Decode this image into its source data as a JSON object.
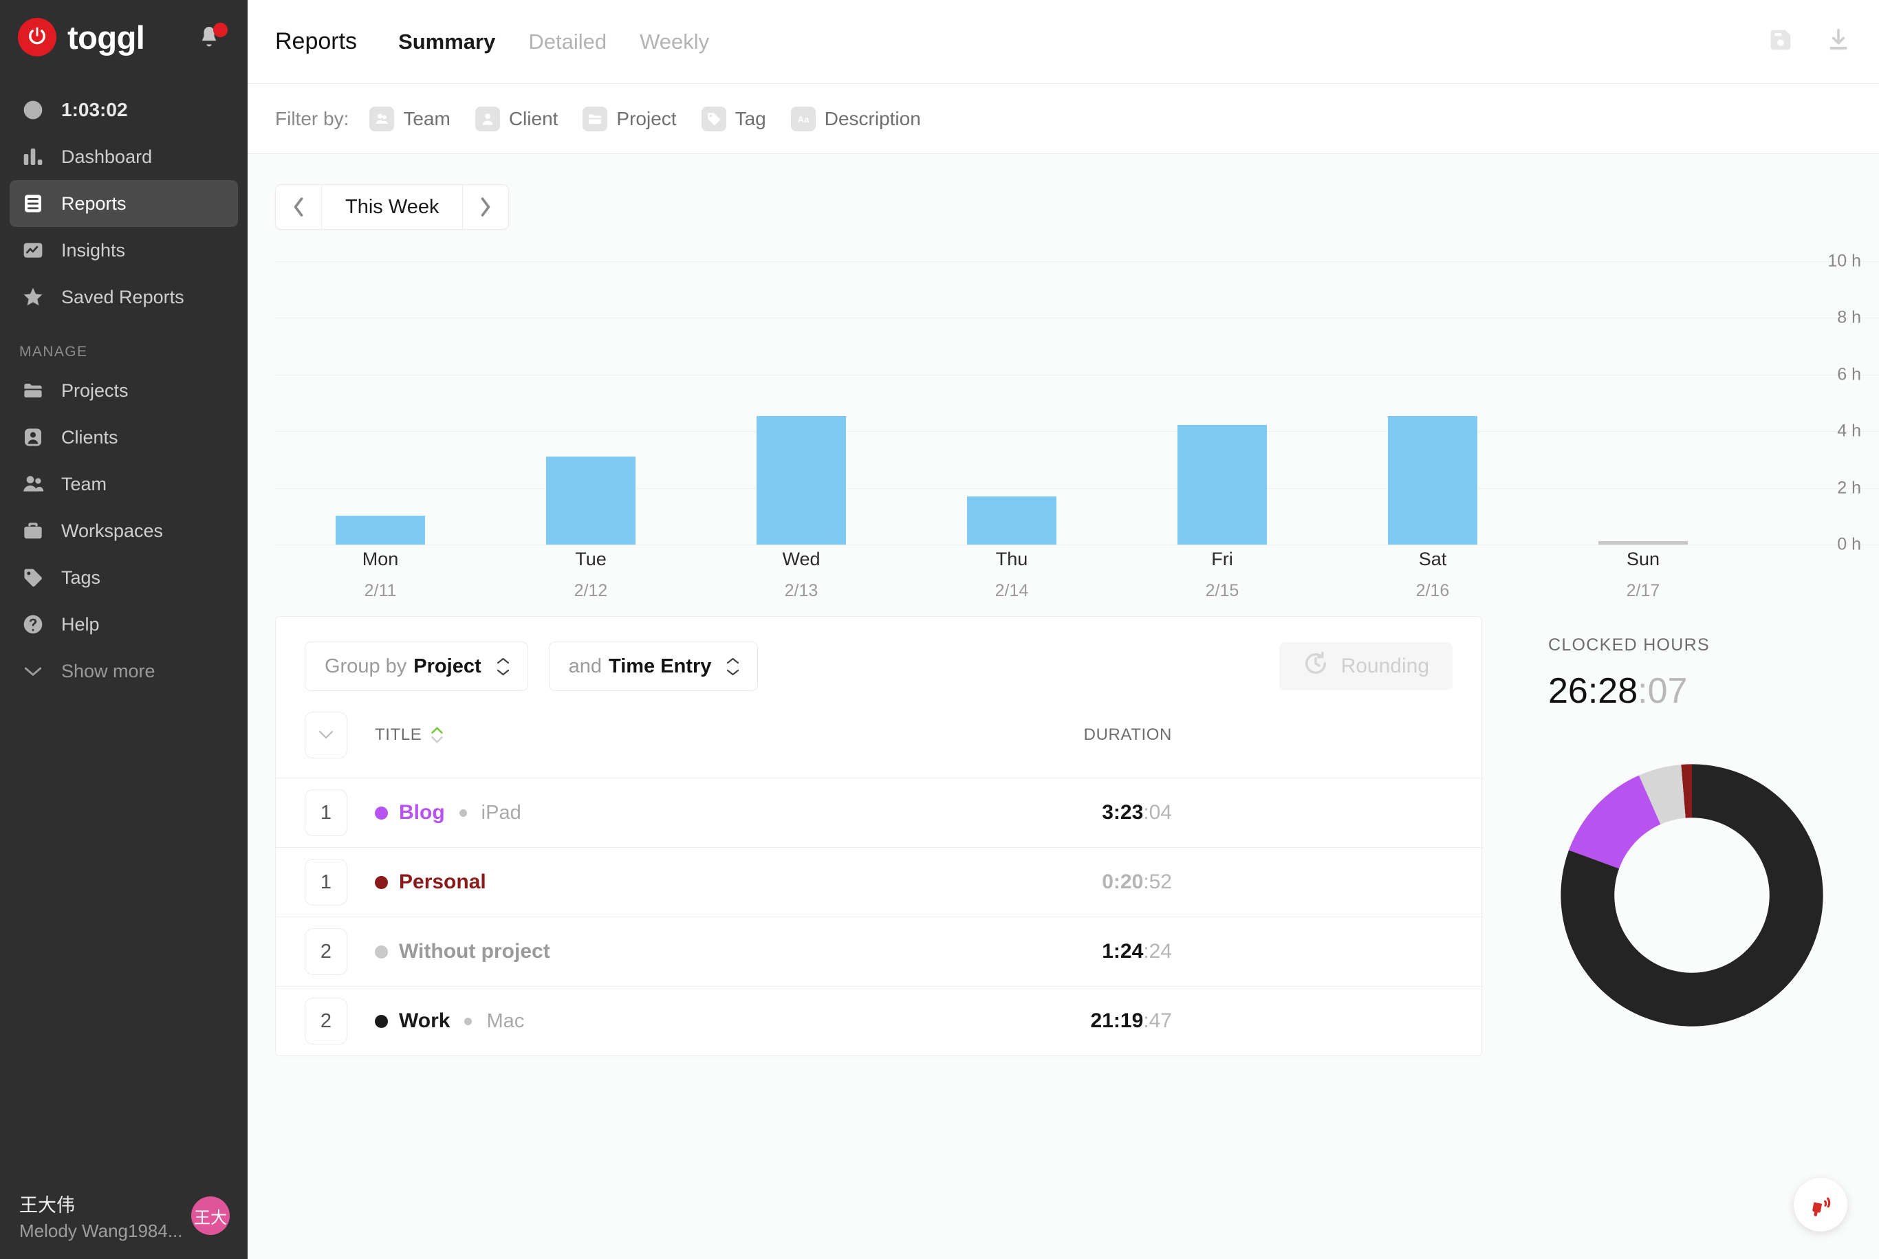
{
  "brand": {
    "name": "toggl",
    "logo_icon": "power-icon",
    "bell_icon": "bell-icon",
    "has_notification": true
  },
  "sidebar": {
    "timer": {
      "label": "1:03:02",
      "icon": "clock-icon"
    },
    "primary_items": [
      {
        "label": "Dashboard",
        "icon": "bar-chart-icon",
        "active": false
      },
      {
        "label": "Reports",
        "icon": "report-icon",
        "active": true
      },
      {
        "label": "Insights",
        "icon": "insights-icon",
        "active": false
      },
      {
        "label": "Saved Reports",
        "icon": "star-icon",
        "active": false
      }
    ],
    "manage_label": "MANAGE",
    "manage_items": [
      {
        "label": "Projects",
        "icon": "folder-icon"
      },
      {
        "label": "Clients",
        "icon": "person-square-icon"
      },
      {
        "label": "Team",
        "icon": "people-icon"
      },
      {
        "label": "Workspaces",
        "icon": "briefcase-icon"
      },
      {
        "label": "Tags",
        "icon": "tag-icon"
      },
      {
        "label": "Help",
        "icon": "question-circle-icon"
      }
    ],
    "show_more": {
      "label": "Show more",
      "icon": "chevron-down-icon"
    },
    "user": {
      "name": "王大伟",
      "email": "Melody Wang1984...",
      "avatar_initials": "王大"
    }
  },
  "header": {
    "page_title": "Reports",
    "tabs": [
      {
        "label": "Summary",
        "active": true
      },
      {
        "label": "Detailed",
        "active": false
      },
      {
        "label": "Weekly",
        "active": false
      }
    ],
    "actions": [
      {
        "name": "save-report-button",
        "icon": "floppy-disk-icon"
      },
      {
        "name": "download-button",
        "icon": "download-icon"
      }
    ]
  },
  "filterbar": {
    "label": "Filter by:",
    "filters": [
      {
        "label": "Team",
        "icon": "team-icon"
      },
      {
        "label": "Client",
        "icon": "client-icon"
      },
      {
        "label": "Project",
        "icon": "project-icon"
      },
      {
        "label": "Tag",
        "icon": "tag-icon"
      },
      {
        "label": "Description",
        "icon": "description-icon"
      }
    ]
  },
  "date_nav": {
    "prev_icon": "chevron-left-icon",
    "label": "This Week",
    "next_icon": "chevron-right-icon"
  },
  "chart_data": {
    "type": "bar",
    "title": "",
    "xlabel": "",
    "ylabel": "",
    "ylim": [
      0,
      10
    ],
    "yticks": [
      "0 h",
      "2 h",
      "4 h",
      "6 h",
      "8 h",
      "10 h"
    ],
    "ytick_values": [
      0,
      2,
      4,
      6,
      8,
      10
    ],
    "grid": true,
    "bar_color": "#7fc9f2",
    "zero_marker_color": "#c8c8c8",
    "categories": [
      "Mon",
      "Tue",
      "Wed",
      "Thu",
      "Fri",
      "Sat",
      "Sun"
    ],
    "category_dates": [
      "2/11",
      "2/12",
      "2/13",
      "2/14",
      "2/15",
      "2/16",
      "2/17"
    ],
    "values": [
      1.03,
      3.1,
      4.53,
      1.7,
      4.23,
      4.53,
      0
    ],
    "unit": "hours"
  },
  "summary_panel": {
    "group_by": {
      "prefix": "Group by",
      "value": "Project",
      "icon": "chevron-updown-icon"
    },
    "subgroup_by": {
      "prefix": "and",
      "value": "Time Entry",
      "icon": "chevron-updown-icon"
    },
    "rounding": {
      "label": "Rounding",
      "icon": "rounding-clock-icon",
      "disabled": true
    },
    "table": {
      "expand_icon": "chevron-down-icon",
      "columns": [
        "TITLE",
        "DURATION"
      ],
      "sort": {
        "column": "TITLE",
        "direction": "asc",
        "active_color": "#7ac943"
      },
      "rows": [
        {
          "count": "1",
          "project": "Blog",
          "project_color": "#b853f0",
          "sub": "iPad",
          "duration_main": "3:23",
          "duration_sec": "04",
          "duration_dim": false
        },
        {
          "count": "1",
          "project": "Personal",
          "project_color": "#8b1a1a",
          "sub": "",
          "duration_main": "0:20",
          "duration_sec": "52",
          "duration_dim": true
        },
        {
          "count": "2",
          "project": "Without project",
          "project_color": "#c9c9c9",
          "sub": "",
          "duration_main": "1:24",
          "duration_sec": "24",
          "duration_dim": false
        },
        {
          "count": "2",
          "project": "Work",
          "project_color": "#1a1a1a",
          "sub": "Mac",
          "duration_main": "21:19",
          "duration_sec": "47",
          "duration_dim": false
        }
      ]
    }
  },
  "clocked": {
    "label": "CLOCKED HOURS",
    "total_hm": "26:28",
    "total_ss": "07",
    "donut": {
      "type": "pie",
      "slices": [
        {
          "name": "Personal",
          "value": 0.3478,
          "percent": 1.31,
          "color": "#8b1a1a"
        },
        {
          "name": "Without project",
          "value": 1.4067,
          "percent": 5.31,
          "color": "#d6d6d6"
        },
        {
          "name": "Blog",
          "value": 3.3844,
          "percent": 12.78,
          "color": "#b853f0"
        },
        {
          "name": "Work",
          "value": 21.3297,
          "percent": 80.59,
          "color": "#242424"
        }
      ],
      "total_hours": 26.4686
    }
  },
  "fab": {
    "icon": "megaphone-icon",
    "color": "#d32b25"
  }
}
